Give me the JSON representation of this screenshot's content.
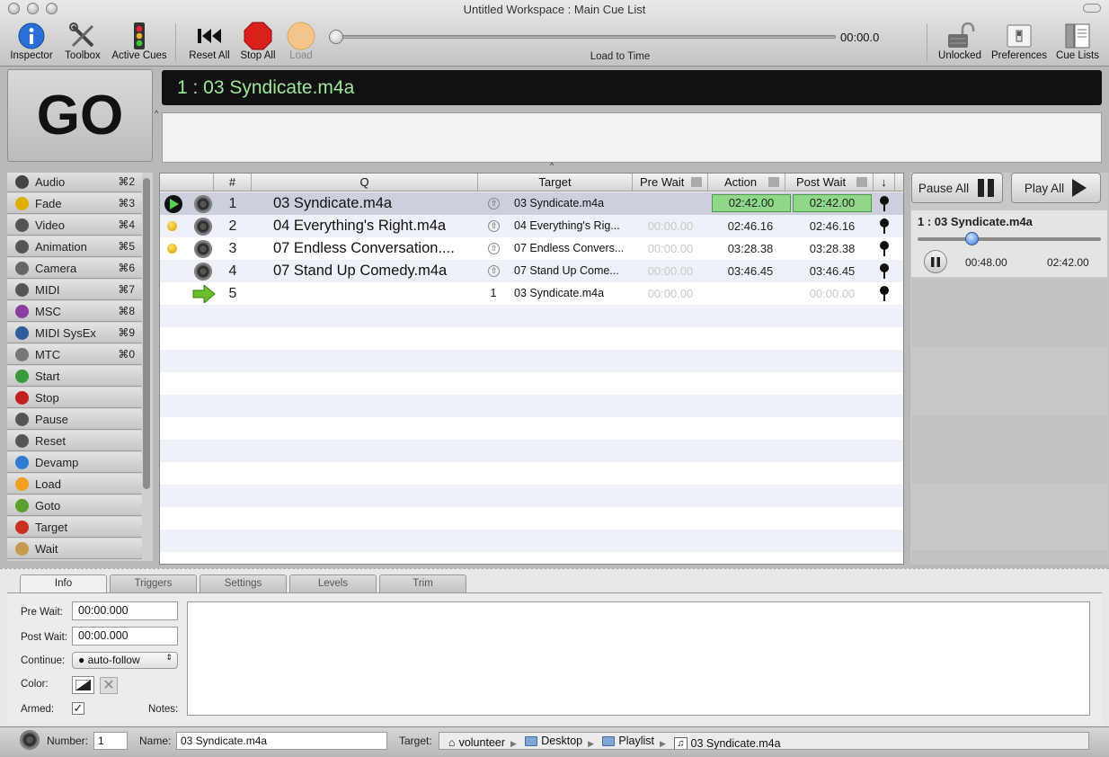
{
  "window": {
    "title": "Untitled Workspace : Main Cue List"
  },
  "toolbar": {
    "inspector": "Inspector",
    "toolbox": "Toolbox",
    "active_cues": "Active Cues",
    "reset_all": "Reset All",
    "stop_all": "Stop All",
    "load": "Load",
    "timecode": "00:00.0",
    "load_to_time": "Load to Time",
    "unlocked": "Unlocked",
    "preferences": "Preferences",
    "cue_lists": "Cue Lists"
  },
  "go_button": "GO",
  "standby": "1 : 03 Syndicate.m4a",
  "palette": [
    {
      "label": "Audio",
      "shortcut": "⌘2",
      "icon": "audio-icon",
      "color": "#444444"
    },
    {
      "label": "Fade",
      "shortcut": "⌘3",
      "icon": "fade-icon",
      "color": "#e0b000"
    },
    {
      "label": "Video",
      "shortcut": "⌘4",
      "icon": "video-icon",
      "color": "#555555"
    },
    {
      "label": "Animation",
      "shortcut": "⌘5",
      "icon": "animation-icon",
      "color": "#555555"
    },
    {
      "label": "Camera",
      "shortcut": "⌘6",
      "icon": "camera-icon",
      "color": "#666666"
    },
    {
      "label": "MIDI",
      "shortcut": "⌘7",
      "icon": "midi-icon",
      "color": "#555555"
    },
    {
      "label": "MSC",
      "shortcut": "⌘8",
      "icon": "msc-icon",
      "color": "#8a3fa0"
    },
    {
      "label": "MIDI SysEx",
      "shortcut": "⌘9",
      "icon": "midi-sysex-icon",
      "color": "#2f5d9a"
    },
    {
      "label": "MTC",
      "shortcut": "⌘0",
      "icon": "mtc-icon",
      "color": "#777777"
    },
    {
      "label": "Start",
      "shortcut": "",
      "icon": "start-icon",
      "color": "#3a9a3a"
    },
    {
      "label": "Stop",
      "shortcut": "",
      "icon": "stop-icon",
      "color": "#c02020"
    },
    {
      "label": "Pause",
      "shortcut": "",
      "icon": "pause-icon",
      "color": "#555555"
    },
    {
      "label": "Reset",
      "shortcut": "",
      "icon": "reset-icon",
      "color": "#555555"
    },
    {
      "label": "Devamp",
      "shortcut": "",
      "icon": "devamp-icon",
      "color": "#2e7bd0"
    },
    {
      "label": "Load",
      "shortcut": "",
      "icon": "load-icon",
      "color": "#f0a020"
    },
    {
      "label": "Goto",
      "shortcut": "",
      "icon": "goto-icon",
      "color": "#5aa02a"
    },
    {
      "label": "Target",
      "shortcut": "",
      "icon": "target-icon",
      "color": "#c83020"
    },
    {
      "label": "Wait",
      "shortcut": "",
      "icon": "wait-icon",
      "color": "#c89a50"
    }
  ],
  "cue_list": {
    "headers": {
      "number": "#",
      "q": "Q",
      "target": "Target",
      "pre_wait": "Pre Wait",
      "action": "Action",
      "post_wait": "Post Wait"
    },
    "rows": [
      {
        "number": "1",
        "name": "03 Syndicate.m4a",
        "target_num": "",
        "target": "03 Syndicate.m4a",
        "pre_wait": "",
        "action": "02:42.00",
        "post_wait": "02:42.00",
        "state": "playing",
        "type": "audio",
        "selected": true
      },
      {
        "number": "2",
        "name": "04 Everything's Right.m4a",
        "target_num": "",
        "target": "04 Everything's Rig...",
        "pre_wait": "00:00.00",
        "action": "02:46.16",
        "post_wait": "02:46.16",
        "state": "loaded",
        "type": "audio"
      },
      {
        "number": "3",
        "name": "07 Endless Conversation....",
        "target_num": "",
        "target": "07 Endless Convers...",
        "pre_wait": "00:00.00",
        "action": "03:28.38",
        "post_wait": "03:28.38",
        "state": "loaded",
        "type": "audio"
      },
      {
        "number": "4",
        "name": "07 Stand Up Comedy.m4a",
        "target_num": "",
        "target": "07 Stand Up Come...",
        "pre_wait": "00:00.00",
        "action": "03:46.45",
        "post_wait": "03:46.45",
        "state": "",
        "type": "audio"
      },
      {
        "number": "5",
        "name": "",
        "target_num": "1",
        "target": "03 Syndicate.m4a",
        "pre_wait": "00:00.00",
        "action": "",
        "post_wait": "00:00.00",
        "state": "",
        "type": "goto"
      }
    ]
  },
  "active_cues": {
    "pause_all": "Pause All",
    "play_all": "Play All",
    "item": {
      "title": "1 : 03 Syndicate.m4a",
      "elapsed": "00:48.00",
      "duration": "02:42.00",
      "progress": 0.296
    }
  },
  "inspector": {
    "tabs": [
      "Info",
      "Triggers",
      "Settings",
      "Levels",
      "Trim"
    ],
    "active_tab": "Info",
    "pre_wait_label": "Pre Wait:",
    "pre_wait": "00:00.000",
    "post_wait_label": "Post Wait:",
    "post_wait": "00:00.000",
    "continue_label": "Continue:",
    "continue_value": "auto-follow",
    "color_label": "Color:",
    "armed_label": "Armed:",
    "armed": true,
    "notes_label": "Notes:"
  },
  "statusbar": {
    "number_label": "Number:",
    "number": "1",
    "name_label": "Name:",
    "name": "03 Syndicate.m4a",
    "target_label": "Target:",
    "path": [
      "volunteer",
      "Desktop",
      "Playlist",
      "03 Syndicate.m4a"
    ]
  }
}
